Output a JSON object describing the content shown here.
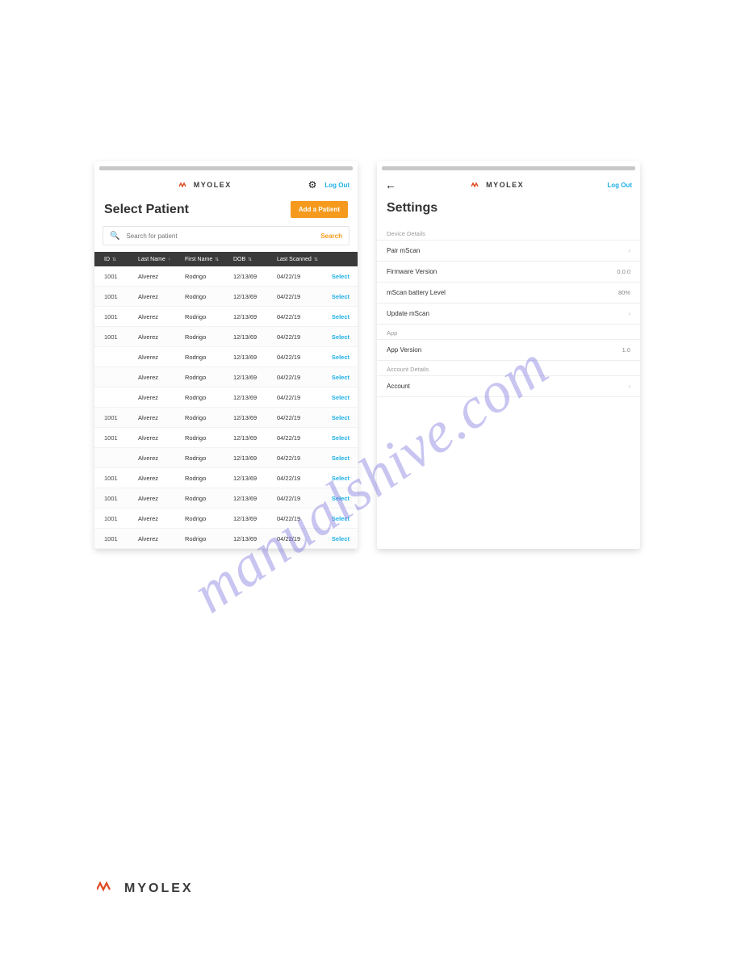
{
  "brand": "MYOLEX",
  "logout": "Log Out",
  "watermark": "manualshive.com",
  "left": {
    "title": "Select Patient",
    "add_button": "Add a Patient",
    "search": {
      "placeholder": "Search for patient",
      "button": "Search"
    },
    "columns": {
      "id": "ID",
      "last": "Last Name",
      "first": "First Name",
      "dob": "DOB",
      "scanned": "Last Scanned"
    },
    "select_label": "Select",
    "rows": [
      {
        "id": "1001",
        "last": "Alverez",
        "first": "Rodrigo",
        "dob": "12/13/69",
        "scanned": "04/22/19"
      },
      {
        "id": "1001",
        "last": "Alverez",
        "first": "Rodrigo",
        "dob": "12/13/69",
        "scanned": "04/22/19"
      },
      {
        "id": "1001",
        "last": "Alverez",
        "first": "Rodrigo",
        "dob": "12/13/69",
        "scanned": "04/22/19"
      },
      {
        "id": "1001",
        "last": "Alverez",
        "first": "Rodrigo",
        "dob": "12/13/69",
        "scanned": "04/22/19"
      },
      {
        "id": "",
        "last": "Alverez",
        "first": "Rodrigo",
        "dob": "12/13/69",
        "scanned": "04/22/19"
      },
      {
        "id": "",
        "last": "Alverez",
        "first": "Rodrigo",
        "dob": "12/13/69",
        "scanned": "04/22/19"
      },
      {
        "id": "",
        "last": "Alverez",
        "first": "Rodrigo",
        "dob": "12/13/69",
        "scanned": "04/22/19"
      },
      {
        "id": "1001",
        "last": "Alverez",
        "first": "Rodrigo",
        "dob": "12/13/69",
        "scanned": "04/22/19"
      },
      {
        "id": "1001",
        "last": "Alverez",
        "first": "Rodrigo",
        "dob": "12/13/69",
        "scanned": "04/22/19"
      },
      {
        "id": "",
        "last": "Alverez",
        "first": "Rodrigo",
        "dob": "12/13/69",
        "scanned": "04/22/19"
      },
      {
        "id": "1001",
        "last": "Alverez",
        "first": "Rodrigo",
        "dob": "12/13/69",
        "scanned": "04/22/19"
      },
      {
        "id": "1001",
        "last": "Alverez",
        "first": "Rodrigo",
        "dob": "12/13/69",
        "scanned": "04/22/19"
      },
      {
        "id": "1001",
        "last": "Alverez",
        "first": "Rodrigo",
        "dob": "12/13/69",
        "scanned": "04/22/19"
      },
      {
        "id": "1001",
        "last": "Alverez",
        "first": "Rodrigo",
        "dob": "12/13/69",
        "scanned": "04/22/19"
      }
    ]
  },
  "right": {
    "title": "Settings",
    "sections": {
      "device": {
        "label": "Device Details",
        "pair": "Pair mScan",
        "firmware_label": "Firmware Version",
        "firmware_value": "0.0.0",
        "battery_label": "mScan battery Level",
        "battery_value": "80%",
        "update": "Update mScan"
      },
      "app": {
        "label": "App",
        "version_label": "App Version",
        "version_value": "1.0"
      },
      "account": {
        "label": "Account Details",
        "account": "Account"
      }
    }
  }
}
